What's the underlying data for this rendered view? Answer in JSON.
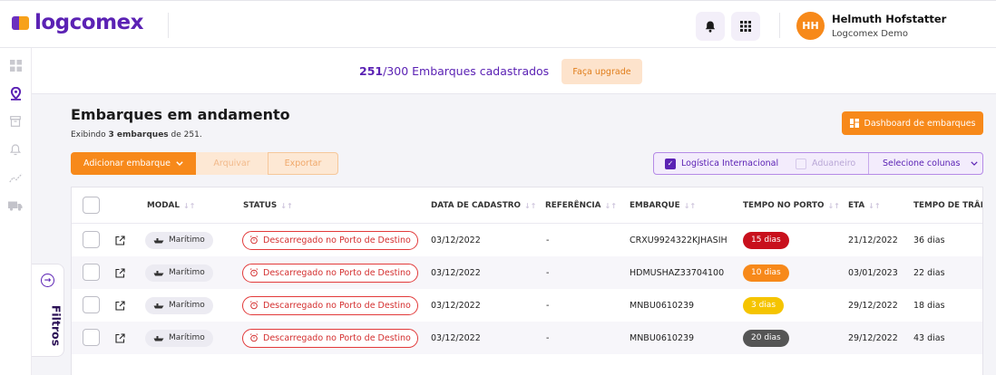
{
  "header": {
    "logo_text": "logcomex",
    "user": {
      "initials": "HH",
      "name": "Helmuth Hofstatter",
      "org": "Logcomex Demo"
    }
  },
  "promo": {
    "count": "251",
    "total": "/300 Embarques cadastrados",
    "upgrade_label": "Faça upgrade"
  },
  "page": {
    "title": "Embarques em andamento",
    "subtitle_prefix": "Exibindo ",
    "subtitle_count": "3 embarques",
    "subtitle_suffix": " de 251.",
    "dashboard_label": "Dashboard de embarques"
  },
  "toolbar": {
    "add_label": "Adicionar embarque",
    "archive_label": "Arquivar",
    "export_label": "Exportar",
    "filter_logistica": "Logística Internacional",
    "filter_aduaneiro": "Aduaneiro",
    "select_columns": "Selecione colunas"
  },
  "filters_tab": {
    "label": "Filtros"
  },
  "table": {
    "columns": {
      "modal": "MODAL",
      "status": "STATUS",
      "data": "DATA DE CADASTRO",
      "ref": "REFERÊNCIA",
      "embarque": "EMBARQUE",
      "tempo": "TEMPO NO PORTO",
      "eta": "ETA",
      "transito": "TEMPO DE TRÂN"
    },
    "rows": [
      {
        "modal": "Marítimo",
        "status": "Descarregado no Porto de Destino",
        "data": "03/12/2022",
        "ref": "-",
        "embarque": "CRXU9924322KJHASIH",
        "tempo": "15 dias",
        "tempo_color": "#c8101c",
        "eta": "21/12/2022",
        "transito": "36 dias"
      },
      {
        "modal": "Marítimo",
        "status": "Descarregado no Porto de Destino",
        "data": "03/12/2022",
        "ref": "-",
        "embarque": "HDMUSHAZ33704100",
        "tempo": "10 dias",
        "tempo_color": "#f7891a",
        "eta": "03/01/2023",
        "transito": "22 dias"
      },
      {
        "modal": "Marítimo",
        "status": "Descarregado no Porto de Destino",
        "data": "03/12/2022",
        "ref": "-",
        "embarque": "MNBU0610239",
        "tempo": "3 dias",
        "tempo_color": "#f5c400",
        "eta": "29/12/2022",
        "transito": "18 dias"
      },
      {
        "modal": "Marítimo",
        "status": "Descarregado no Porto de Destino",
        "data": "03/12/2022",
        "ref": "-",
        "embarque": "MNBU0610239",
        "tempo": "20 dias",
        "tempo_color": "#555555",
        "eta": "29/12/2022",
        "transito": "43 dias"
      }
    ]
  },
  "colors": {
    "brand_purple": "#5b22b4",
    "brand_orange": "#f7891a",
    "status_red": "#e23a3a"
  }
}
